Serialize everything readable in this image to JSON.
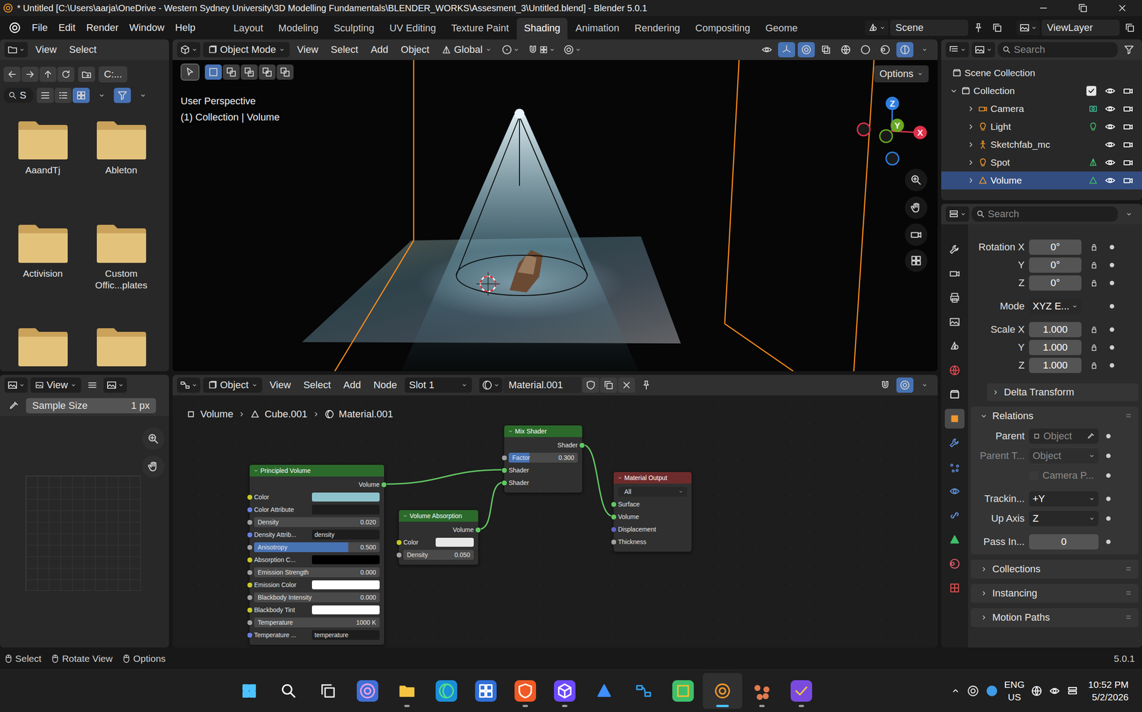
{
  "window": {
    "title": "* Untitled [C:\\Users\\aarja\\OneDrive - Western Sydney University\\3D Modelling Fundamentals\\BLENDER_WORKS\\Assesment_3\\Untitled.blend] - Blender 5.0.1"
  },
  "menus": [
    "File",
    "Edit",
    "Render",
    "Window",
    "Help"
  ],
  "workspaces": [
    {
      "label": "Layout",
      "selected": false
    },
    {
      "label": "Modeling",
      "selected": false
    },
    {
      "label": "Sculpting",
      "selected": false
    },
    {
      "label": "UV Editing",
      "selected": false
    },
    {
      "label": "Texture Paint",
      "selected": false
    },
    {
      "label": "Shading",
      "selected": true
    },
    {
      "label": "Animation",
      "selected": false
    },
    {
      "label": "Rendering",
      "selected": false
    },
    {
      "label": "Compositing",
      "selected": false
    },
    {
      "label": "Geome",
      "selected": false
    }
  ],
  "scene": {
    "name": "Scene",
    "view_layer": "ViewLayer"
  },
  "file_browser": {
    "menus": [
      "View",
      "Select"
    ],
    "path": "C:...",
    "search": "S",
    "view_modes": [
      {
        "kind": "list",
        "selected": false
      },
      {
        "kind": "detail",
        "selected": false
      },
      {
        "kind": "grid4",
        "selected": true
      }
    ],
    "filter_on": true,
    "folders": [
      {
        "name": "AaandTj"
      },
      {
        "name": "Ableton"
      },
      {
        "name": "Activision"
      },
      {
        "name": "Custom Offic...plates"
      },
      {
        "name": ""
      },
      {
        "name": ""
      }
    ]
  },
  "image_editor": {
    "menu": "View",
    "sample_label": "Sample Size",
    "sample_value": "1 px"
  },
  "viewport": {
    "mode": "Object Mode",
    "menus": [
      "View",
      "Select",
      "Add",
      "Object"
    ],
    "orientation": "Global",
    "options": "Options",
    "perspective": "User Perspective",
    "context": "(1) Collection | Volume",
    "select_modes": [
      {
        "kind": "sel-new",
        "selected": true
      },
      {
        "kind": "sel-extend",
        "selected": false
      },
      {
        "kind": "sel-sub",
        "selected": false
      },
      {
        "kind": "sel-inv",
        "selected": false
      },
      {
        "kind": "sel-and",
        "selected": false
      }
    ],
    "toggles": [
      {
        "kind": "eye",
        "on": false
      },
      {
        "kind": "gizmo",
        "on": true
      },
      {
        "kind": "overlay",
        "on": true
      },
      {
        "kind": "xray",
        "on": false
      },
      {
        "kind": "wire",
        "on": false
      },
      {
        "kind": "solid",
        "on": false
      },
      {
        "kind": "matprev",
        "on": false
      },
      {
        "kind": "rendered",
        "on": true
      }
    ],
    "axes": [
      {
        "label": "Z",
        "color": "#2f7fe0"
      },
      {
        "label": "Y",
        "color": "#6aa624"
      },
      {
        "label": "X",
        "color": "#e0314b"
      }
    ]
  },
  "node_editor": {
    "mode": "Object",
    "menus": [
      "View",
      "Select",
      "Add",
      "Node"
    ],
    "slot": "Slot 1",
    "material": "Material.001",
    "breadcrumb": [
      "Volume",
      "Cube.001",
      "Material.001"
    ],
    "toggles": [
      {
        "kind": "snap",
        "on": false
      },
      {
        "kind": "overlay",
        "on": true
      }
    ],
    "nodes": [
      {
        "title": "Principled Volume",
        "color": "#2b6a2b",
        "rows": [
          {
            "kind": "output",
            "label": "Volume",
            "color": "#63c763"
          },
          {
            "kind": "color",
            "label": "Color",
            "color": "#c7c729",
            "swatch": "#8ec3cc"
          },
          {
            "kind": "field",
            "label": "Color Attribute",
            "color": "#6b7fe0",
            "value": ""
          },
          {
            "kind": "value",
            "label": "Density",
            "color": "#a1a1a1",
            "value": "0.020"
          },
          {
            "kind": "field",
            "label": "Density Attrib...",
            "color": "#6b7fe0",
            "value": "density"
          },
          {
            "kind": "slider",
            "label": "Anisotropy",
            "color": "#a1a1a1",
            "value": "0.500",
            "level": 0.75
          },
          {
            "kind": "color",
            "label": "Absorption C...",
            "color": "#c7c729",
            "swatch": "#000000"
          },
          {
            "kind": "value",
            "label": "Emission Strength",
            "color": "#a1a1a1",
            "value": "0.000"
          },
          {
            "kind": "color",
            "label": "Emission Color",
            "color": "#c7c729",
            "swatch": "#ffffff"
          },
          {
            "kind": "value",
            "label": "Blackbody Intensity",
            "color": "#a1a1a1",
            "value": "0.000"
          },
          {
            "kind": "color",
            "label": "Blackbody Tint",
            "color": "#c7c729",
            "swatch": "#ffffff"
          },
          {
            "kind": "value",
            "label": "Temperature",
            "color": "#a1a1a1",
            "value": "1000 K"
          },
          {
            "kind": "field",
            "label": "Temperature ...",
            "color": "#6b7fe0",
            "value": "temperature"
          }
        ]
      },
      {
        "title": "Volume Absorption",
        "color": "#2b6a2b",
        "rows": [
          {
            "kind": "output",
            "label": "Volume",
            "color": "#63c763"
          },
          {
            "kind": "color",
            "label": "Color",
            "color": "#c7c729",
            "swatch": "#e8e8e8"
          },
          {
            "kind": "value",
            "label": "Density",
            "color": "#a1a1a1",
            "value": "0.050"
          }
        ]
      },
      {
        "title": "Mix Shader",
        "color": "#2b6a2b",
        "rows": [
          {
            "kind": "output",
            "label": "Shader",
            "color": "#63c763"
          },
          {
            "kind": "slider",
            "label": "Factor",
            "color": "#a1a1a1",
            "value": "0.300",
            "level": 0.3
          },
          {
            "kind": "input",
            "label": "Shader",
            "color": "#63c763"
          },
          {
            "kind": "input",
            "label": "Shader",
            "color": "#63c763"
          }
        ]
      },
      {
        "title": "Material Output",
        "color": "#6e2b2b",
        "rows": [
          {
            "kind": "dropdown",
            "label": "",
            "value": "All"
          },
          {
            "kind": "input",
            "label": "Surface",
            "color": "#63c763"
          },
          {
            "kind": "input",
            "label": "Volume",
            "color": "#63c763"
          },
          {
            "kind": "input",
            "label": "Displacement",
            "color": "#6363c7"
          },
          {
            "kind": "input",
            "label": "Thickness",
            "color": "#a1a1a1"
          }
        ]
      }
    ],
    "links": [
      {
        "from": 0,
        "from_row": 0,
        "to": 2,
        "to_row": 2
      },
      {
        "from": 1,
        "from_row": 0,
        "to": 2,
        "to_row": 3
      },
      {
        "from": 2,
        "from_row": 0,
        "to": 3,
        "to_row": 2
      }
    ]
  },
  "outliner": {
    "search": "Search",
    "root": "Scene Collection",
    "collection": {
      "name": "Collection",
      "checked": true,
      "expanded": true
    },
    "items": [
      {
        "name": "Camera",
        "kind": "camera",
        "selected": false,
        "visible": true
      },
      {
        "name": "Light",
        "kind": "light",
        "selected": false,
        "visible": true
      },
      {
        "name": "Sketchfab_mc",
        "kind": "empty",
        "selected": false,
        "visible": true
      },
      {
        "name": "Spot",
        "kind": "spot",
        "selected": false,
        "visible": true
      },
      {
        "name": "Volume",
        "kind": "mesh",
        "selected": true,
        "visible": true
      }
    ]
  },
  "properties": {
    "search": "Search",
    "tabs": [
      {
        "kind": "tool",
        "selected": false
      },
      {
        "kind": "render",
        "selected": false
      },
      {
        "kind": "output",
        "selected": false
      },
      {
        "kind": "viewlayer",
        "selected": false
      },
      {
        "kind": "scene",
        "selected": false
      },
      {
        "kind": "world",
        "selected": false
      },
      {
        "kind": "collection",
        "selected": false
      },
      {
        "kind": "object",
        "selected": true
      },
      {
        "kind": "modifier",
        "selected": false
      },
      {
        "kind": "particles",
        "selected": false
      },
      {
        "kind": "physics",
        "selected": false
      },
      {
        "kind": "constraint",
        "selected": false
      },
      {
        "kind": "data",
        "selected": false
      },
      {
        "kind": "material",
        "selected": false
      },
      {
        "kind": "texture",
        "selected": false
      }
    ],
    "rotation": [
      {
        "label": "Rotation X",
        "value": "0°"
      },
      {
        "label": "Y",
        "value": "0°"
      },
      {
        "label": "Z",
        "value": "0°"
      }
    ],
    "mode": {
      "label": "Mode",
      "value": "XYZ E..."
    },
    "scale": [
      {
        "label": "Scale X",
        "value": "1.000"
      },
      {
        "label": "Y",
        "value": "1.000"
      },
      {
        "label": "Z",
        "value": "1.000"
      }
    ],
    "delta": {
      "label": "Delta Transform",
      "expanded": false
    },
    "relations": {
      "label": "Relations",
      "expanded": true,
      "rows": [
        {
          "kind": "picker",
          "label": "Parent",
          "value": "Object",
          "disabled": false
        },
        {
          "kind": "dropdown",
          "label": "Parent T...",
          "value": "Object",
          "disabled": true
        },
        {
          "kind": "checkbox",
          "label": "Camera P...",
          "checked": false,
          "disabled": true
        },
        {
          "kind": "dropdown",
          "label": "Trackin...",
          "value": "+Y",
          "disabled": false
        },
        {
          "kind": "dropdown",
          "label": "Up Axis",
          "value": "Z",
          "disabled": false
        },
        {
          "kind": "number",
          "label": "Pass In...",
          "value": "0",
          "disabled": false
        }
      ]
    },
    "panels": [
      {
        "label": "Collections",
        "expanded": false
      },
      {
        "label": "Instancing",
        "expanded": false
      },
      {
        "label": "Motion Paths",
        "expanded": false
      }
    ]
  },
  "status_bar": {
    "items": [
      "Select",
      "Rotate View",
      "Options"
    ],
    "version": "5.0.1"
  },
  "taskbar": {
    "apps": [
      {
        "kind": "start",
        "running": false,
        "active": false
      },
      {
        "kind": "search",
        "running": false,
        "active": false
      },
      {
        "kind": "taskview",
        "running": false,
        "active": false
      },
      {
        "kind": "copilot",
        "running": false,
        "active": false
      },
      {
        "kind": "explorer",
        "running": true,
        "active": false
      },
      {
        "kind": "edge",
        "running": false,
        "active": false
      },
      {
        "kind": "store",
        "running": false,
        "active": false
      },
      {
        "kind": "brave",
        "running": true,
        "active": false
      },
      {
        "kind": "proton",
        "running": true,
        "active": false
      },
      {
        "kind": "wave",
        "running": false,
        "active": false
      },
      {
        "kind": "vscode",
        "running": false,
        "active": false
      },
      {
        "kind": "git",
        "running": false,
        "active": false
      },
      {
        "kind": "blender",
        "running": true,
        "active": true
      },
      {
        "kind": "claude",
        "running": true,
        "active": false
      },
      {
        "kind": "vs",
        "running": true,
        "active": false
      }
    ],
    "lang": "ENG",
    "region": "US",
    "time": "10:52 PM",
    "date": "5/2/2026"
  }
}
